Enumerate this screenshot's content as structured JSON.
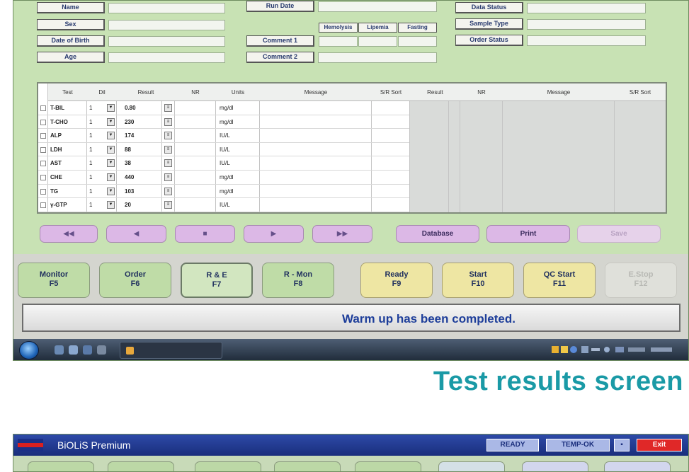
{
  "results_screen": {
    "header": {
      "name_label": "Name",
      "sex_label": "Sex",
      "dob_label": "Date of Birth",
      "age_label": "Age",
      "run_date_label": "Run Date",
      "run_date_value": "",
      "comment1_label": "Comment 1",
      "comment2_label": "Comment 2",
      "hemolysis_label": "Hemolysis",
      "lipemia_label": "Lipemia",
      "fasting_label": "Fasting",
      "data_status_label": "Data Status",
      "sample_type_label": "Sample Type",
      "order_status_label": "Order Status"
    },
    "table": {
      "columns": [
        "Test",
        "Dil",
        "Result",
        "NR",
        "Units",
        "Message",
        "S/R Sort",
        "Result",
        "NR",
        "Message",
        "S/R Sort"
      ],
      "rows": [
        {
          "test": "T-BIL",
          "dil": "1",
          "result": "0.80",
          "units": "mg/dl"
        },
        {
          "test": "T-CHO",
          "dil": "1",
          "result": "230",
          "units": "mg/dl"
        },
        {
          "test": "ALP",
          "dil": "1",
          "result": "174",
          "units": "IU/L"
        },
        {
          "test": "LDH",
          "dil": "1",
          "result": "88",
          "units": "IU/L"
        },
        {
          "test": "AST",
          "dil": "1",
          "result": "38",
          "units": "IU/L"
        },
        {
          "test": "CHE",
          "dil": "1",
          "result": "440",
          "units": "mg/dl"
        },
        {
          "test": "TG",
          "dil": "1",
          "result": "103",
          "units": "mg/dl"
        },
        {
          "test": "γ-GTP",
          "dil": "1",
          "result": "20",
          "units": "IU/L"
        }
      ]
    },
    "nav": {
      "first": "◀◀",
      "prev": "◀",
      "stop": "■",
      "next": "▶",
      "last": "▶▶",
      "database": "Database",
      "print": "Print",
      "save": "Save"
    },
    "function_keys": [
      {
        "name": "Monitor",
        "key": "F5"
      },
      {
        "name": "Order",
        "key": "F6"
      },
      {
        "name": "R & E",
        "key": "F7"
      },
      {
        "name": "R - Mon",
        "key": "F8"
      },
      {
        "name": "Ready",
        "key": "F9"
      },
      {
        "name": "Start",
        "key": "F10"
      },
      {
        "name": "QC Start",
        "key": "F11"
      },
      {
        "name": "E.Stop",
        "key": "F12"
      }
    ],
    "status_message": "Warm up has been completed."
  },
  "caption": "Test results screen",
  "premium_window": {
    "app_title": "BiOLiS Premium",
    "status_ready": "READY",
    "status_temp": "TEMP-OK",
    "exit_label": "Exit"
  },
  "colors": {
    "panel": "#c8e2b4",
    "status_text": "#1e3e9a",
    "caption": "#1a9aa6",
    "exit": "#e02828"
  }
}
